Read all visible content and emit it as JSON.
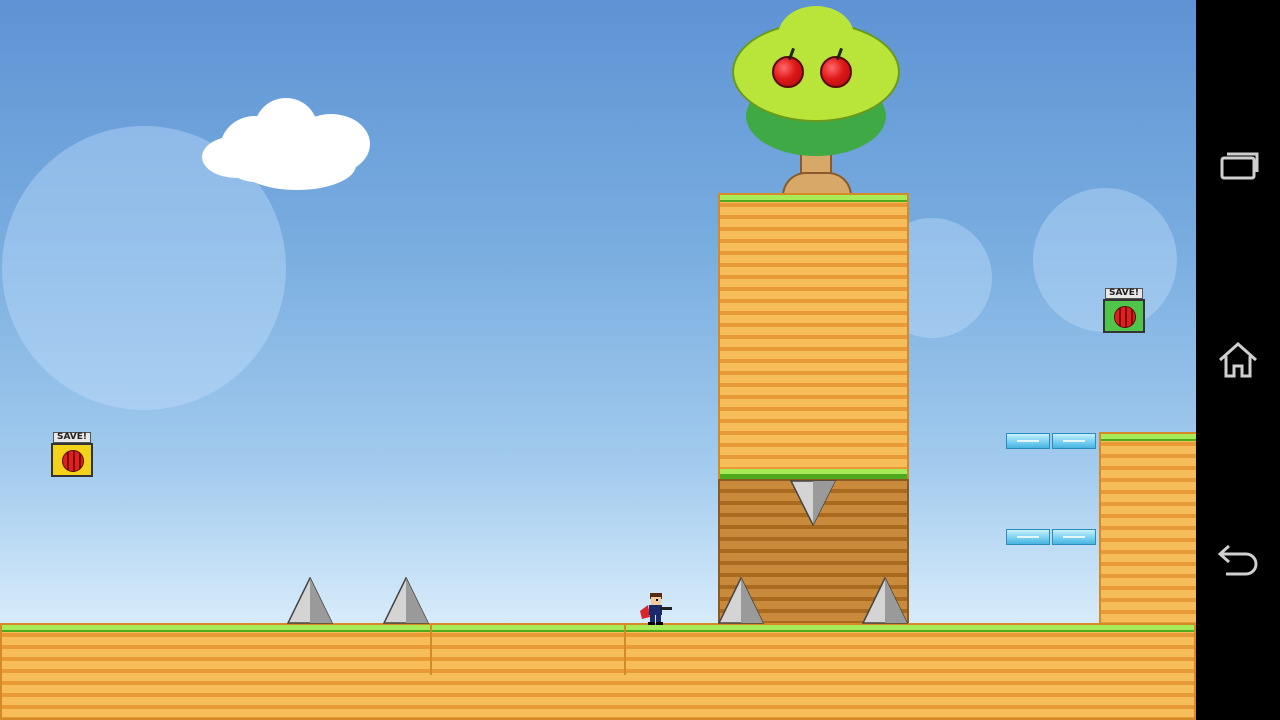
{
  "game": {
    "save_points": [
      {
        "label": "SAVE!",
        "state": "inactive",
        "color": "#f3d21a"
      },
      {
        "label": "SAVE!",
        "state": "active",
        "color": "#4fc54a"
      }
    ],
    "tree": {
      "apples": 2
    }
  },
  "colors": {
    "sky_top": "#5d93d4",
    "sky_bottom": "#eaf6fd",
    "grass": "#8fdc3c",
    "dirt": "#f7bd5b",
    "apple": "#e01818",
    "spike": "#c8c8c8"
  },
  "system_nav": {
    "icons": [
      "recent-apps-icon",
      "home-icon",
      "back-icon"
    ]
  }
}
